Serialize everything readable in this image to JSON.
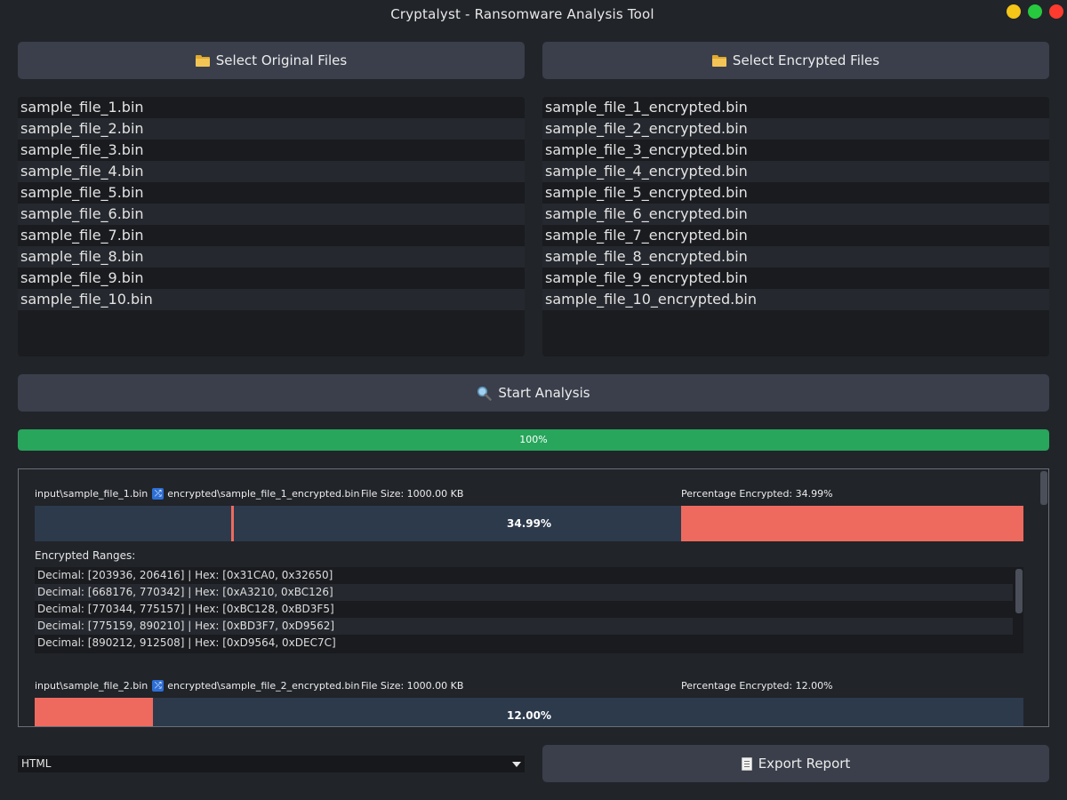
{
  "window": {
    "title": "Cryptalyst - Ransomware Analysis Tool",
    "controls": [
      {
        "name": "minimize",
        "color": "#f5c518"
      },
      {
        "name": "maximize",
        "color": "#27c93f"
      },
      {
        "name": "close",
        "color": "#ff3b30"
      }
    ]
  },
  "buttons": {
    "select_original": "Select Original Files",
    "select_encrypted": "Select Encrypted Files",
    "start_analysis": "Start Analysis",
    "export_report": "Export Report"
  },
  "original_files": [
    "sample_file_1.bin",
    "sample_file_2.bin",
    "sample_file_3.bin",
    "sample_file_4.bin",
    "sample_file_5.bin",
    "sample_file_6.bin",
    "sample_file_7.bin",
    "sample_file_8.bin",
    "sample_file_9.bin",
    "sample_file_10.bin"
  ],
  "encrypted_files": [
    "sample_file_1_encrypted.bin",
    "sample_file_2_encrypted.bin",
    "sample_file_3_encrypted.bin",
    "sample_file_4_encrypted.bin",
    "sample_file_5_encrypted.bin",
    "sample_file_6_encrypted.bin",
    "sample_file_7_encrypted.bin",
    "sample_file_8_encrypted.bin",
    "sample_file_9_encrypted.bin",
    "sample_file_10_encrypted.bin"
  ],
  "progress": {
    "value": 1.0,
    "label": "100%",
    "color": "#27a65c"
  },
  "results": [
    {
      "original_path": "input\\sample_file_1.bin",
      "encrypted_path": "encrypted\\sample_file_1_encrypted.bin",
      "file_size": "File Size: 1000.00 KB",
      "percentage_text": "Percentage Encrypted: 34.99%",
      "bar_label": "34.99%",
      "encrypted_segments": [
        [
          0.199,
          0.2016
        ],
        [
          0.6542,
          1.0
        ]
      ],
      "ranges_label": "Encrypted Ranges:",
      "ranges": [
        "Decimal: [203936, 206416] | Hex: [0x31CA0, 0x32650]",
        "Decimal: [668176, 770342] | Hex: [0xA3210, 0xBC126]",
        "Decimal: [770344, 775157] | Hex: [0xBC128, 0xBD3F5]",
        "Decimal: [775159, 890210] | Hex: [0xBD3F7, 0xD9562]",
        "Decimal: [890212, 912508] | Hex: [0xD9564, 0xDEC7C]"
      ]
    },
    {
      "original_path": "input\\sample_file_2.bin",
      "encrypted_path": "encrypted\\sample_file_2_encrypted.bin",
      "file_size": "File Size: 1000.00 KB",
      "percentage_text": "Percentage Encrypted: 12.00%",
      "bar_label": "12.00%",
      "encrypted_segments": [
        [
          0.0,
          0.12
        ]
      ],
      "ranges_label": "",
      "ranges": []
    }
  ],
  "export_format": {
    "selected": "HTML"
  },
  "colors": {
    "background": "#212429",
    "button": "#3a3f4b",
    "encrypted_segment": "#ee6a5e",
    "bar_background": "#2c3a4c",
    "swap_icon": "#2d6fd6"
  }
}
